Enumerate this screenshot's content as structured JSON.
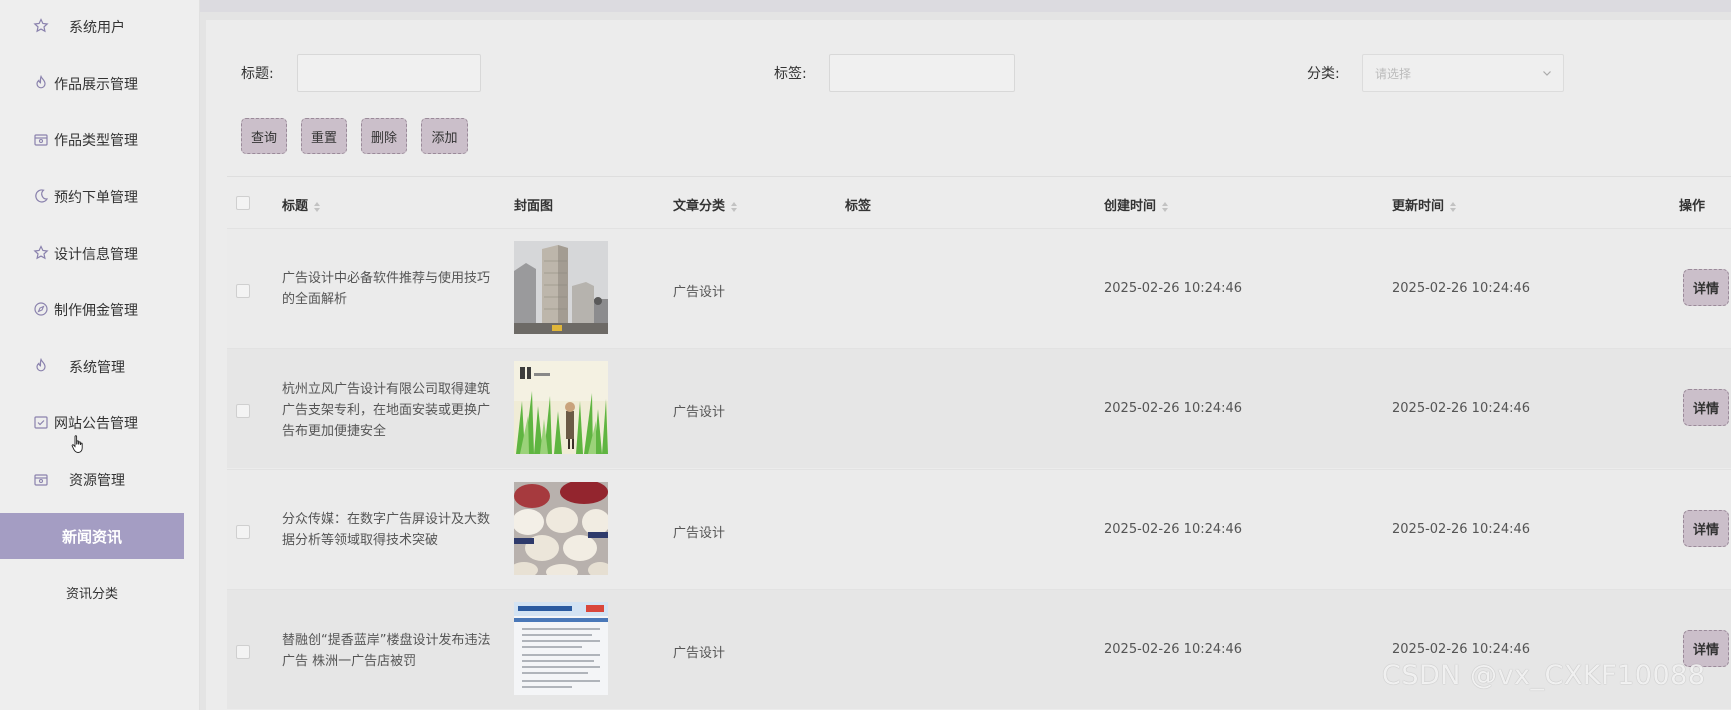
{
  "sidebar": {
    "items": [
      {
        "label": "系统用户",
        "icon": "star-icon"
      },
      {
        "label": "作品展示管理",
        "icon": "fire-icon"
      },
      {
        "label": "作品类型管理",
        "icon": "box-icon"
      },
      {
        "label": "预约下单管理",
        "icon": "moon-icon"
      },
      {
        "label": "设计信息管理",
        "icon": "star-icon"
      },
      {
        "label": "制作佣金管理",
        "icon": "compass-icon"
      },
      {
        "label": "系统管理",
        "icon": "fire-icon"
      },
      {
        "label": "网站公告管理",
        "icon": "check-square-icon"
      },
      {
        "label": "资源管理",
        "icon": "box-icon"
      }
    ],
    "active_item": "新闻资讯",
    "sub_item": "资讯分类"
  },
  "filters": {
    "title_label": "标题:",
    "tag_label": "标签:",
    "category_label": "分类:",
    "category_placeholder": "请选择"
  },
  "actions": {
    "query": "查询",
    "reset": "重置",
    "delete": "删除",
    "add": "添加"
  },
  "table": {
    "headers": {
      "title": "标题",
      "cover": "封面图",
      "category": "文章分类",
      "tags": "标签",
      "created": "创建时间",
      "updated": "更新时间",
      "ops": "操作"
    },
    "rows": [
      {
        "title": "广告设计中必备软件推荐与使用技巧的全面解析",
        "category": "广告设计",
        "tags": "",
        "created": "2025-02-26 10:24:46",
        "updated": "2025-02-26 10:24:46",
        "action": "详情"
      },
      {
        "title": "杭州立风广告设计有限公司取得建筑广告支架专利，在地面安装或更换广告布更加便捷安全",
        "category": "广告设计",
        "tags": "",
        "created": "2025-02-26 10:24:46",
        "updated": "2025-02-26 10:24:46",
        "action": "详情"
      },
      {
        "title": "分众传媒：在数字广告屏设计及大数据分析等领域取得技术突破",
        "category": "广告设计",
        "tags": "",
        "created": "2025-02-26 10:24:46",
        "updated": "2025-02-26 10:24:46",
        "action": "详情"
      },
      {
        "title": "替融创“提香蓝岸”楼盘设计发布违法广告 株洲一广告店被罚",
        "category": "广告设计",
        "tags": "",
        "created": "2025-02-26 10:24:46",
        "updated": "2025-02-26 10:24:46",
        "action": "详情"
      }
    ]
  },
  "watermark": "CSDN @vx_CXKF10088",
  "colors": {
    "accent": "#a49dc3",
    "button_bg": "#cbbfca",
    "button_border": "#9a8a99"
  }
}
